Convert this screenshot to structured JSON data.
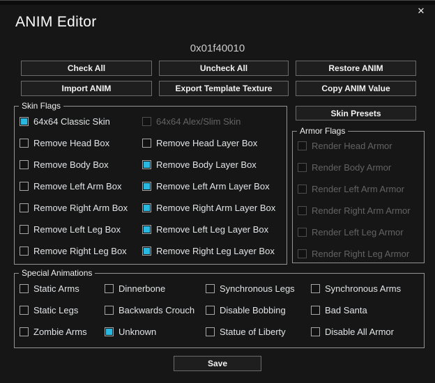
{
  "window": {
    "title": "ANIM Editor",
    "close_glyph": "✕"
  },
  "anim_value": "0x01f40010",
  "toolbar": {
    "check_all": "Check All",
    "uncheck_all": "Uncheck All",
    "restore_anim": "Restore ANIM",
    "import_anim": "Import ANIM",
    "export_template_texture": "Export Template Texture",
    "copy_anim_value": "Copy ANIM Value",
    "skin_presets": "Skin Presets",
    "save": "Save"
  },
  "colors": {
    "accent_checked": "#29b8e0",
    "dialog_bg": "#161616"
  },
  "skin_flags": {
    "title": "Skin Flags",
    "items": [
      {
        "label": "64x64 Classic Skin",
        "checked": true,
        "disabled": false
      },
      {
        "label": "64x64 Alex/Slim Skin",
        "checked": false,
        "disabled": true
      },
      {
        "label": "Remove Head Box",
        "checked": false,
        "disabled": false
      },
      {
        "label": "Remove Head Layer Box",
        "checked": false,
        "disabled": false
      },
      {
        "label": "Remove Body Box",
        "checked": false,
        "disabled": false
      },
      {
        "label": "Remove Body Layer Box",
        "checked": true,
        "disabled": false
      },
      {
        "label": "Remove Left Arm Box",
        "checked": false,
        "disabled": false
      },
      {
        "label": "Remove Left Arm Layer Box",
        "checked": true,
        "disabled": false
      },
      {
        "label": "Remove Right Arm Box",
        "checked": false,
        "disabled": false
      },
      {
        "label": "Remove Right Arm Layer Box",
        "checked": true,
        "disabled": false
      },
      {
        "label": "Remove Left Leg Box",
        "checked": false,
        "disabled": false
      },
      {
        "label": "Remove Left Leg Layer Box",
        "checked": true,
        "disabled": false
      },
      {
        "label": "Remove Right Leg Box",
        "checked": false,
        "disabled": false
      },
      {
        "label": "Remove Right Leg Layer Box",
        "checked": true,
        "disabled": false
      }
    ]
  },
  "armor_flags": {
    "title": "Armor Flags",
    "items": [
      {
        "label": "Render Head Armor",
        "checked": false,
        "disabled": true
      },
      {
        "label": "Render Body Armor",
        "checked": false,
        "disabled": true
      },
      {
        "label": "Render Left Arm Armor",
        "checked": false,
        "disabled": true
      },
      {
        "label": "Render Right Arm Armor",
        "checked": false,
        "disabled": true
      },
      {
        "label": "Render Left Leg Armor",
        "checked": false,
        "disabled": true
      },
      {
        "label": "Render Right Leg Armor",
        "checked": false,
        "disabled": true
      }
    ]
  },
  "special_animations": {
    "title": "Special Animations",
    "items": [
      {
        "label": "Static Arms",
        "checked": false,
        "disabled": false
      },
      {
        "label": "Dinnerbone",
        "checked": false,
        "disabled": false
      },
      {
        "label": "Synchronous Legs",
        "checked": false,
        "disabled": false
      },
      {
        "label": "Synchronous Arms",
        "checked": false,
        "disabled": false
      },
      {
        "label": "Static Legs",
        "checked": false,
        "disabled": false
      },
      {
        "label": "Backwards Crouch",
        "checked": false,
        "disabled": false
      },
      {
        "label": "Disable Bobbing",
        "checked": false,
        "disabled": false
      },
      {
        "label": "Bad Santa",
        "checked": false,
        "disabled": false
      },
      {
        "label": "Zombie Arms",
        "checked": false,
        "disabled": false
      },
      {
        "label": "Unknown",
        "checked": true,
        "disabled": false
      },
      {
        "label": "Statue of Liberty",
        "checked": false,
        "disabled": false
      },
      {
        "label": "Disable All Armor",
        "checked": false,
        "disabled": false
      }
    ]
  }
}
